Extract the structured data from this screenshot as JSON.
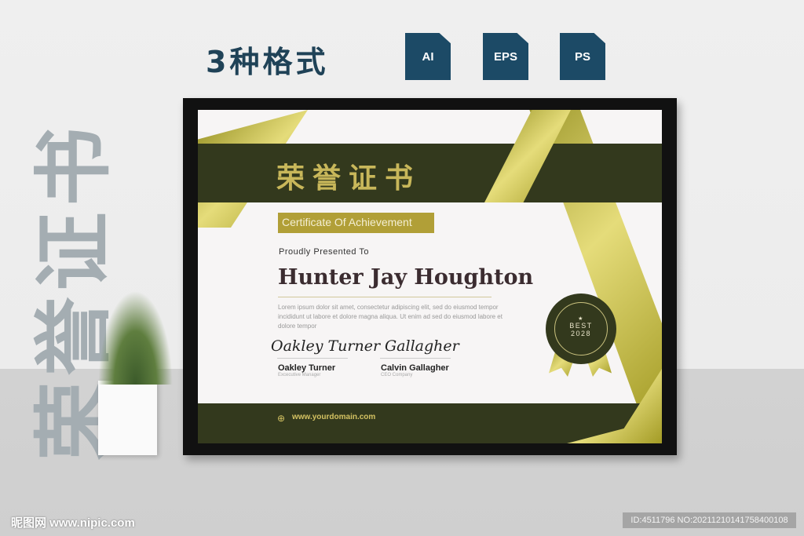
{
  "header": {
    "title": "3种格式",
    "formats": [
      "AI",
      "EPS",
      "PS"
    ]
  },
  "side_text": "荣誉证书",
  "certificate": {
    "title_cn": "荣誉证书",
    "subtitle": "Certificate Of Achievement",
    "presented": "Proudly Presented To",
    "recipient": "Hunter Jay Houghton",
    "body": "Lorem ipsum dolor sit amet, consectetur adipiscing elit, sed do eiusmod tempor incididunt ut labore et dolore magna aliqua. Ut enim ad sed do eiusmod labore et dolore  tempor",
    "signers": [
      {
        "signature": "Oakley Turner",
        "name": "Oakley Turner",
        "role": "Excecutive Manager"
      },
      {
        "signature": "Gallagher",
        "name": "Calvin Gallagher",
        "role": "CEO Company"
      }
    ],
    "badge": {
      "label": "BEST",
      "year": "2028"
    },
    "website": "www.yourdomain.com"
  },
  "watermark": {
    "logo": "昵图网 www.nipic.com",
    "id": "ID:4511796 NO:20211210141758400108"
  },
  "colors": {
    "dark": "#33391d",
    "gold": "#c8b75a",
    "title": "#1f4257"
  }
}
